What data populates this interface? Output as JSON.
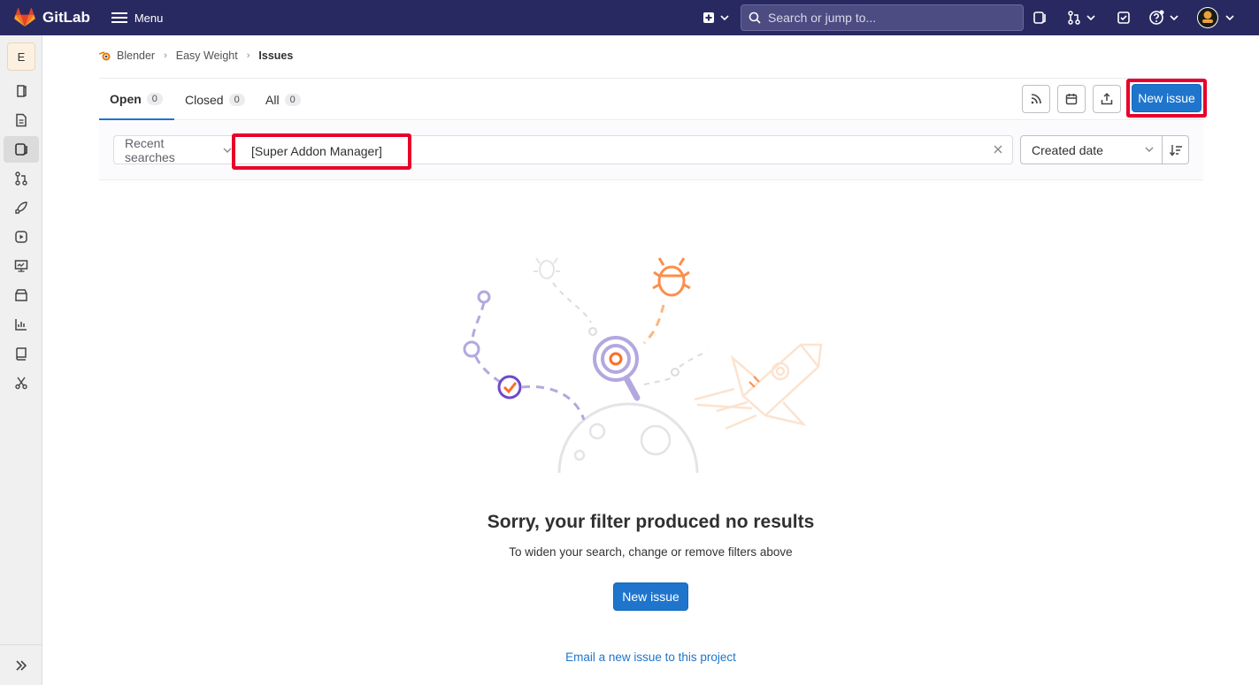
{
  "topbar": {
    "brand": "GitLab",
    "menu_label": "Menu",
    "search_placeholder": "Search or jump to..."
  },
  "sidebar": {
    "project_initial": "E",
    "items": [
      "project-overview",
      "repository",
      "issues",
      "merge-requests",
      "ci-cd",
      "deployments",
      "monitor",
      "packages",
      "analytics",
      "wiki",
      "snippets"
    ],
    "active": "issues"
  },
  "breadcrumb": {
    "group": "Blender",
    "project": "Easy Weight",
    "current": "Issues"
  },
  "tabs": [
    {
      "label": "Open",
      "count": "0"
    },
    {
      "label": "Closed",
      "count": "0"
    },
    {
      "label": "All",
      "count": "0"
    }
  ],
  "actions": {
    "new_issue_label": "New issue"
  },
  "filter": {
    "recent_searches_label": "Recent searches",
    "search_value": "[Super Addon Manager]",
    "sort_label": "Created date"
  },
  "empty_state": {
    "title": "Sorry, your filter produced no results",
    "subtitle": "To widen your search, change or remove filters above",
    "button_label": "New issue",
    "email_link": "Email a new issue to this project"
  },
  "colors": {
    "topbar": "#292961",
    "primary": "#1f75cb",
    "highlight": "#e8002b"
  }
}
